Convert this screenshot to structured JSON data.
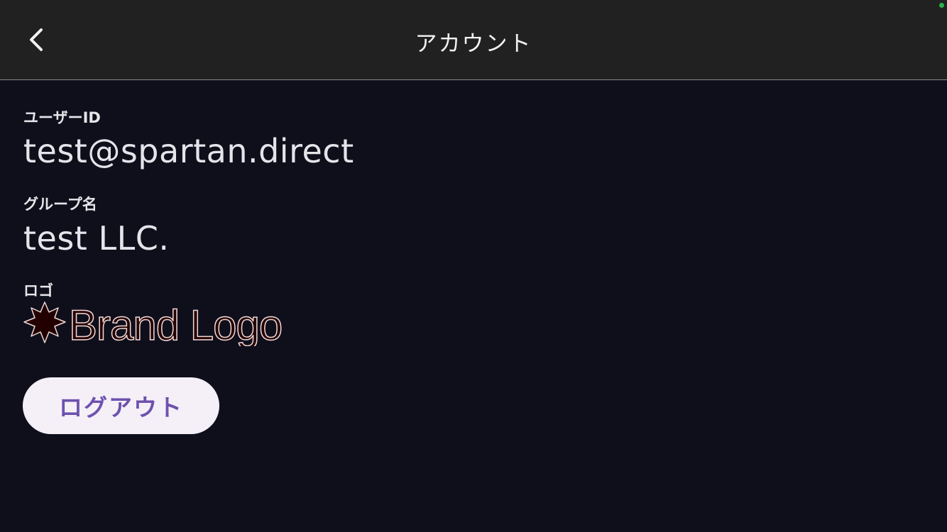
{
  "header": {
    "title": "アカウント",
    "back_icon": "chevron-left-icon"
  },
  "account": {
    "user_id_label": "ユーザーID",
    "user_id_value": "test@spartan.direct",
    "group_label": "グループ名",
    "group_value": "test LLC.",
    "logo_label": "ロゴ",
    "logo_text": "Brand Logo"
  },
  "actions": {
    "logout_label": "ログアウト"
  },
  "colors": {
    "background": "#0f0f1c",
    "appbar": "#212121",
    "button_bg": "#f5eff8",
    "button_text": "#6d52ad",
    "status_dot": "#2bb24c"
  }
}
